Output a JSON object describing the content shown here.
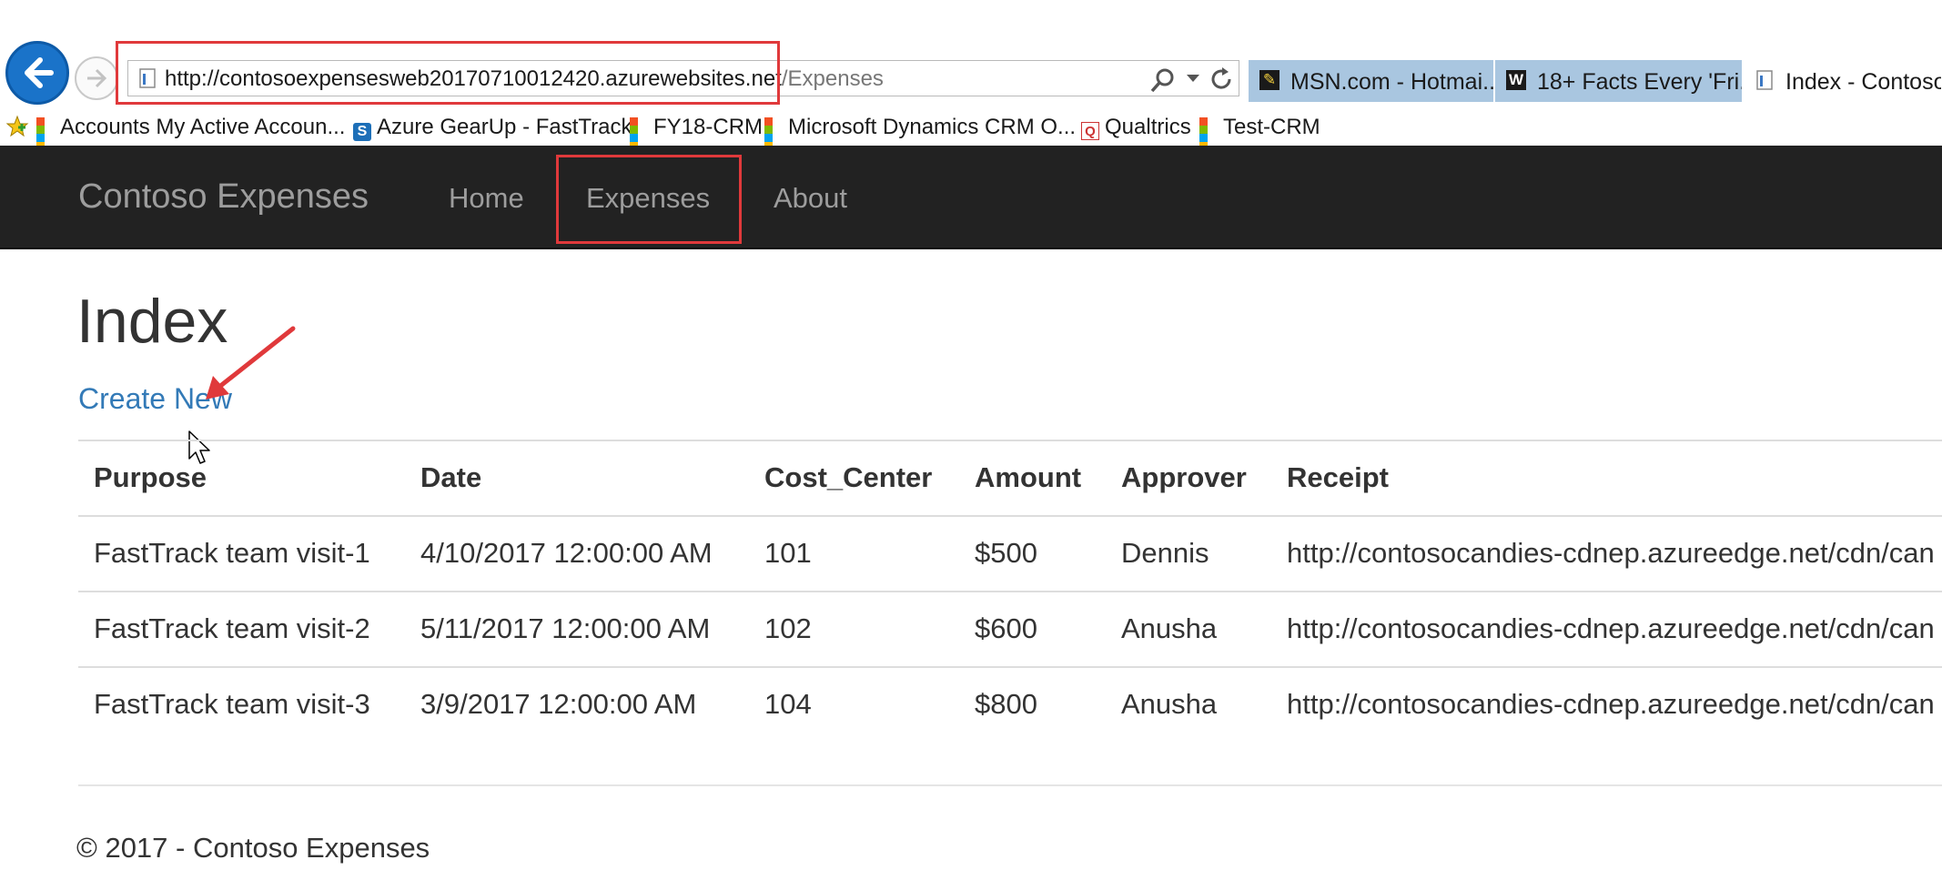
{
  "browser": {
    "address": {
      "host": "http://contosoexpensesweb20170710012420.azurewebsites.net",
      "path": "/Expenses"
    },
    "tabs": [
      {
        "label": "MSN.com - Hotmai...",
        "icon": "msn-icon"
      },
      {
        "label": "18+ Facts Every 'Fri...",
        "icon": "w-icon"
      },
      {
        "label": "Index - Contoso",
        "icon": "page-icon"
      }
    ],
    "favorites": [
      {
        "label": "Accounts My Active Accoun...",
        "icon": "microsoft-logo-icon"
      },
      {
        "label": "Azure GearUp - FastTrack",
        "icon": "sharepoint-icon"
      },
      {
        "label": "FY18-CRM",
        "icon": "microsoft-logo-icon"
      },
      {
        "label": "Microsoft Dynamics CRM O...",
        "icon": "microsoft-logo-icon"
      },
      {
        "label": "Qualtrics",
        "icon": "qualtrics-icon"
      },
      {
        "label": "Test-CRM",
        "icon": "microsoft-logo-icon"
      }
    ]
  },
  "navbar": {
    "brand": "Contoso Expenses",
    "links": [
      "Home",
      "Expenses",
      "About"
    ]
  },
  "main": {
    "title": "Index",
    "create_link": "Create New",
    "table": {
      "headers": [
        "Purpose",
        "Date",
        "Cost_Center",
        "Amount",
        "Approver",
        "Receipt"
      ],
      "rows": [
        [
          "FastTrack team visit-1",
          "4/10/2017 12:00:00 AM",
          "101",
          "$500",
          "Dennis",
          "http://contosocandies-cdnep.azureedge.net/cdn/can"
        ],
        [
          "FastTrack team visit-2",
          "5/11/2017 12:00:00 AM",
          "102",
          "$600",
          "Anusha",
          "http://contosocandies-cdnep.azureedge.net/cdn/can"
        ],
        [
          "FastTrack team visit-3",
          "3/9/2017 12:00:00 AM",
          "104",
          "$800",
          "Anusha",
          "http://contosocandies-cdnep.azureedge.net/cdn/can"
        ]
      ]
    }
  },
  "footer": {
    "text": "© 2017 - Contoso Expenses"
  },
  "colors": {
    "navbar_bg": "#222222",
    "link": "#337ab7",
    "highlight": "#e0393b",
    "back_button": "#1a73c9"
  }
}
